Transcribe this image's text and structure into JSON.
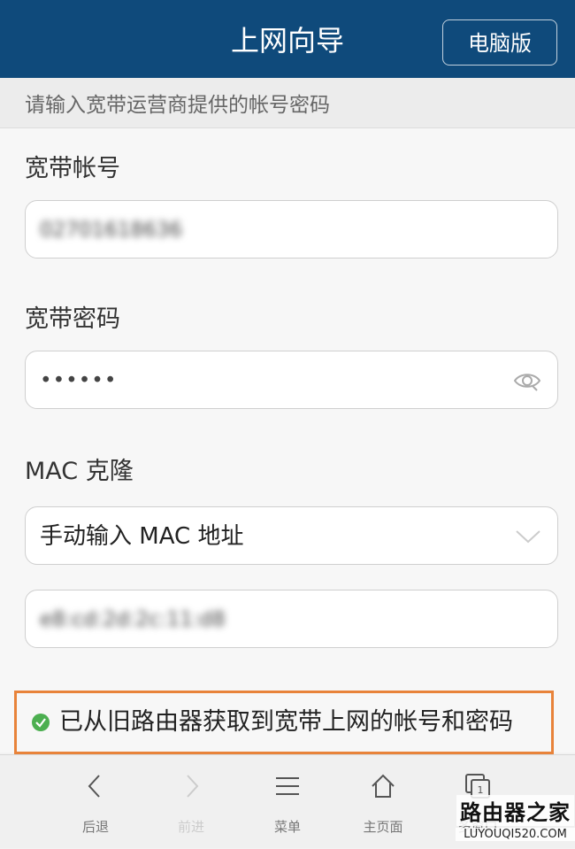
{
  "header": {
    "title": "上网向导",
    "pc_button": "电脑版"
  },
  "instruction": "请输入宽带运营商提供的帐号密码",
  "form": {
    "account_label": "宽带帐号",
    "account_value": "02701618636",
    "password_label": "宽带密码",
    "password_value": "••••••",
    "mac_label": "MAC 克隆",
    "mac_mode_value": "手动输入 MAC 地址",
    "mac_value": "e8:cd:2d:2c:11:d8"
  },
  "status_message": "已从旧路由器获取到宽带上网的帐号和密码",
  "bottom_nav": {
    "back": "后退",
    "forward": "前进",
    "menu": "菜单",
    "home": "主页面",
    "windows": "多窗口"
  },
  "watermark": {
    "cn": "路由器之家",
    "en": "LUYOUQI520.COM"
  },
  "colors": {
    "header_bg": "#0f4a7b",
    "highlight_border": "#e8833a",
    "success_icon": "#4caf50"
  }
}
